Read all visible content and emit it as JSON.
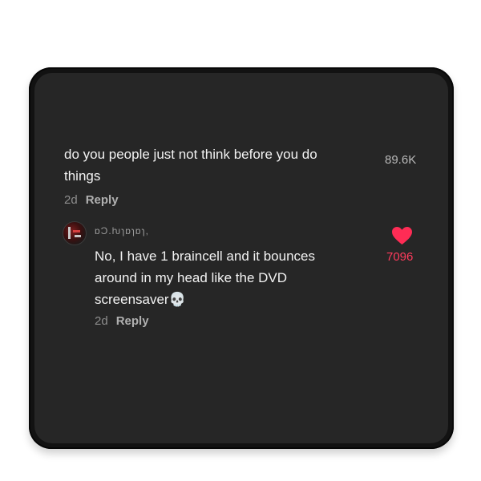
{
  "comment": {
    "text_line1": "do you people just not think before you do",
    "text_line2": "things",
    "age": "2d",
    "reply_label": "Reply",
    "like_count": "89.6K"
  },
  "reply": {
    "username": "ɒƆ.ƕɿɒɿɒɿ,",
    "text_line1": "No, I have 1 braincell and it bounces",
    "text_line2": "around in my head like the DVD",
    "text_line3": "screensaver",
    "emoji": "💀",
    "age": "2d",
    "reply_label": "Reply",
    "like_count": "7096",
    "liked_color": "#ff3b5c"
  },
  "icons": {
    "heart": "heart-icon",
    "avatar": "avatar"
  }
}
